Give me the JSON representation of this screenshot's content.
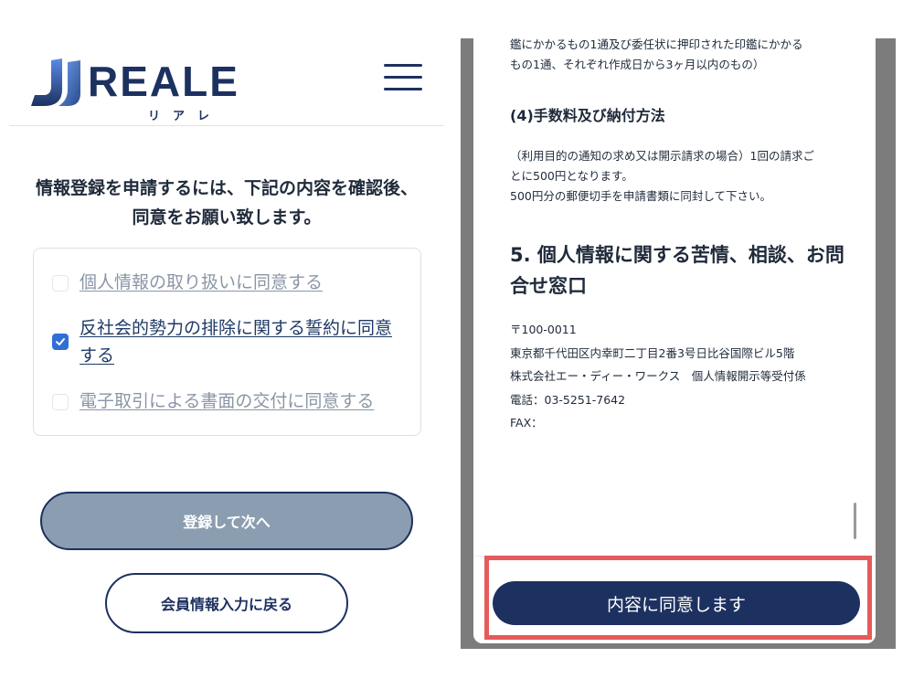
{
  "brand": {
    "logo_text": "REALE",
    "logo_sub": "リアレ",
    "colors": {
      "navy": "#1d3160",
      "check": "#2f6fd6",
      "button_disabled": "#8b9db0",
      "highlight": "#e55a5a"
    }
  },
  "intro": {
    "line1": "情報登録を申請するには、下記の内容を確認後、",
    "line2": "同意をお願い致します。"
  },
  "agreements": [
    {
      "label": "個人情報の取り扱いに同意する",
      "checked": false
    },
    {
      "label": "反社会的勢力の排除に関する誓約に同意する",
      "checked": true
    },
    {
      "label": "電子取引による書面の交付に同意する",
      "checked": false
    }
  ],
  "buttons": {
    "register_next": "登録して次へ",
    "back_to_member": "会員情報入力に戻る",
    "agree": "内容に同意します"
  },
  "document": {
    "top_text_line1": "鑑にかかるもの1通及び委任状に押印された印鑑にかかる",
    "top_text_line2": "もの1通、それぞれ作成日から3ヶ月以内のもの）",
    "section4_title": "(4)手数料及び納付方法",
    "section4_line1": "（利用目的の通知の求め又は開示請求の場合）1回の請求ご",
    "section4_line2": "とに500円となります。",
    "section4_line3": "500円分の郵便切手を申請書類に同封して下さい。",
    "section5_title_line1": "5. 個人情報に関する苦情、相談、お問",
    "section5_title_line2": "合せ窓口",
    "postal": "〒100-0011",
    "address": "東京都千代田区内幸町二丁目2番3号日比谷国際ビル5階",
    "company": "株式会社エー・ディー・ワークス　個人情報開示等受付係",
    "phone": "電話：03-5251-7642",
    "fax": "FAX："
  }
}
